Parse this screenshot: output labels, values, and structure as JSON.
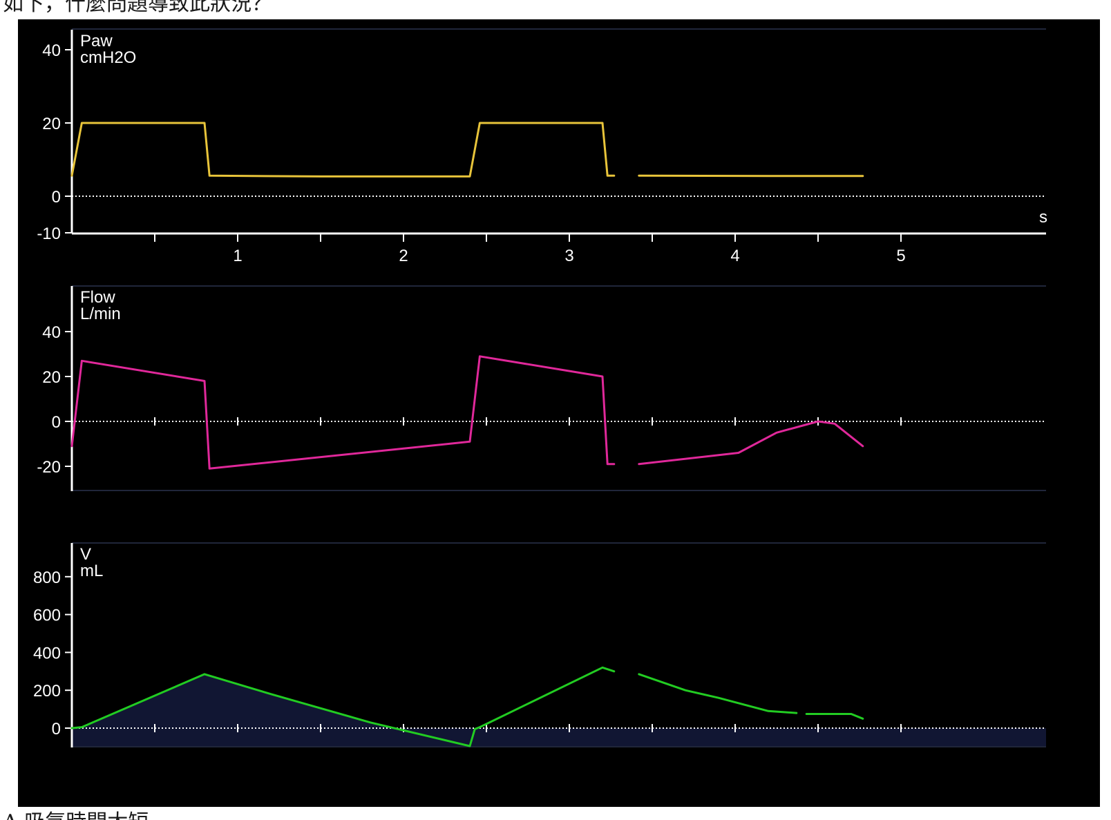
{
  "captions": {
    "top": "如下，什麼問題導致此狀況？",
    "bottom": "A.吸氣時間太短"
  },
  "colors": {
    "background": "#000000",
    "axis": "#ffffff",
    "pressure": "#e8c43a",
    "flow": "#e0289a",
    "volume": "#22cc22",
    "volume_fill": "#111633"
  },
  "chart_data": [
    {
      "type": "line",
      "title": "Paw",
      "ylabel": "cmH2O",
      "xlabel": "s",
      "xlim": [
        0,
        5.6
      ],
      "ylim": [
        -10,
        45
      ],
      "yticks": [
        40,
        20,
        0,
        -10
      ],
      "xticks": [
        1,
        2,
        3,
        4,
        5
      ],
      "grid": false,
      "series": [
        {
          "color": "#e8c43a",
          "segments": [
            [
              [
                0.0,
                5.6
              ],
              [
                0.06,
                20.0
              ],
              [
                0.8,
                20.0
              ],
              [
                0.83,
                5.6
              ],
              [
                1.5,
                5.4
              ],
              [
                2.4,
                5.4
              ],
              [
                2.46,
                20.0
              ],
              [
                3.2,
                20.0
              ],
              [
                3.23,
                5.6
              ],
              [
                3.27,
                5.6
              ]
            ],
            [
              [
                3.42,
                5.6
              ],
              [
                4.2,
                5.5
              ],
              [
                4.77,
                5.5
              ]
            ]
          ]
        }
      ]
    },
    {
      "type": "line",
      "title": "Flow",
      "ylabel": "L/min",
      "xlim": [
        0,
        5.6
      ],
      "ylim": [
        -30,
        60
      ],
      "yticks": [
        40,
        20,
        0,
        -20
      ],
      "grid": false,
      "series": [
        {
          "color": "#e0289a",
          "segments": [
            [
              [
                0.0,
                -11
              ],
              [
                0.06,
                27
              ],
              [
                0.8,
                18
              ],
              [
                0.83,
                -21
              ],
              [
                2.4,
                -9
              ],
              [
                2.46,
                29
              ],
              [
                3.2,
                20
              ],
              [
                3.23,
                -19
              ],
              [
                3.27,
                -19
              ]
            ],
            [
              [
                3.42,
                -19
              ],
              [
                4.02,
                -14
              ],
              [
                4.25,
                -5
              ],
              [
                4.5,
                0
              ],
              [
                4.6,
                -1
              ],
              [
                4.77,
                -11
              ]
            ]
          ]
        }
      ]
    },
    {
      "type": "area",
      "title": "V",
      "ylabel": "mL",
      "xlim": [
        0,
        5.6
      ],
      "ylim": [
        -100,
        1000
      ],
      "yticks": [
        800,
        600,
        400,
        200,
        0
      ],
      "grid": false,
      "series": [
        {
          "color": "#22cc22",
          "segments": [
            [
              [
                0.0,
                0
              ],
              [
                0.06,
                5
              ],
              [
                0.8,
                285
              ],
              [
                1.2,
                180
              ],
              [
                1.8,
                30
              ],
              [
                2.4,
                -95
              ],
              [
                2.43,
                -5
              ],
              [
                2.46,
                5
              ],
              [
                3.2,
                320
              ],
              [
                3.27,
                300
              ]
            ],
            [
              [
                3.42,
                285
              ],
              [
                3.7,
                200
              ],
              [
                3.9,
                160
              ],
              [
                4.2,
                90
              ],
              [
                4.37,
                80
              ]
            ],
            [
              [
                4.43,
                75
              ],
              [
                4.7,
                75
              ],
              [
                4.77,
                50
              ]
            ]
          ],
          "filled_until_x": 2.4
        }
      ]
    }
  ]
}
